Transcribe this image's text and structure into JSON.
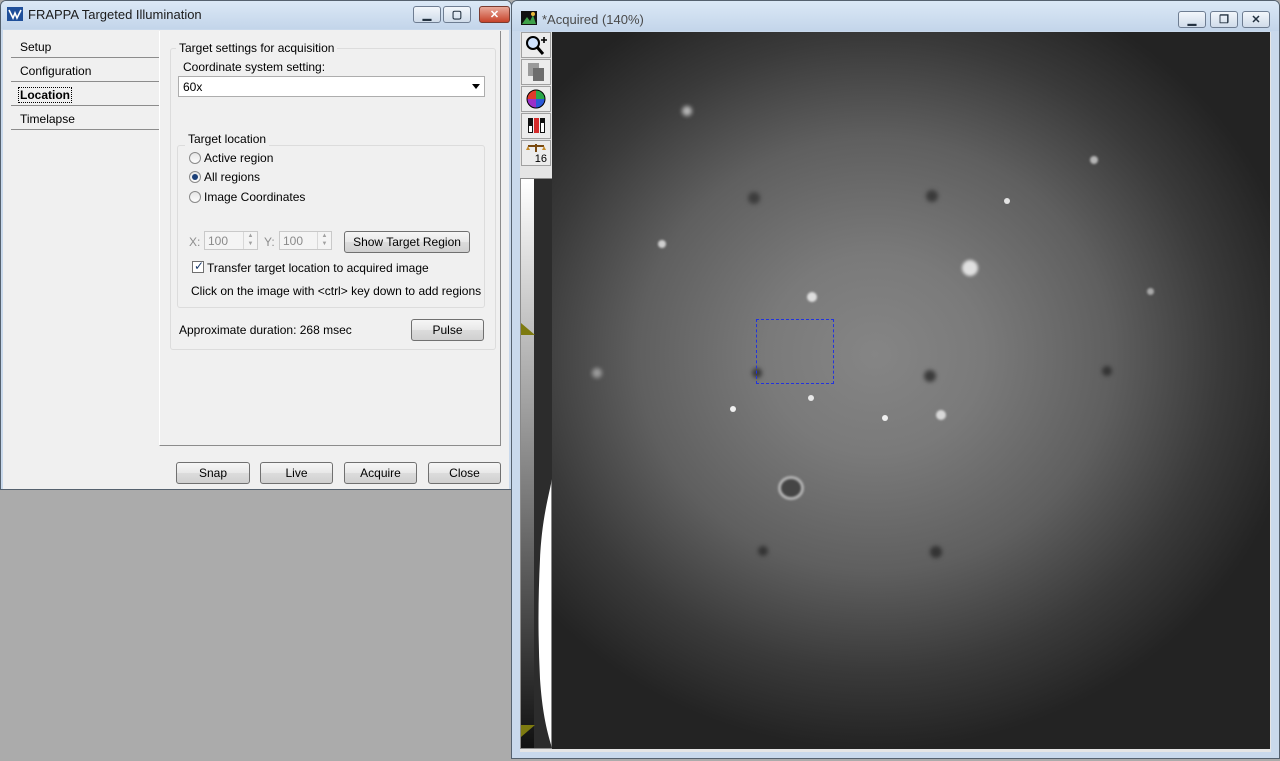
{
  "frappa": {
    "title": "FRAPPA Targeted Illumination",
    "tabs": [
      {
        "label": "Setup"
      },
      {
        "label": "Configuration"
      },
      {
        "label": "Location"
      },
      {
        "label": "Timelapse"
      }
    ],
    "active_tab": "Location",
    "target_settings": {
      "group_title": "Target settings for acquisition",
      "coord_label": "Coordinate system setting:",
      "coord_value": "60x"
    },
    "target_location": {
      "group_title": "Target location",
      "options": [
        {
          "label": "Active region",
          "selected": false
        },
        {
          "label": "All regions",
          "selected": true
        },
        {
          "label": "Image Coordinates",
          "selected": false
        }
      ],
      "x_label": "X:",
      "x_value": "100",
      "y_label": "Y:",
      "y_value": "100",
      "show_target_button": "Show Target Region",
      "transfer_checkbox_label": "Transfer target location to acquired image",
      "transfer_checked": true,
      "hint": "Click on the image with <ctrl> key down to add regions"
    },
    "duration_text": "Approximate duration: 268 msec",
    "pulse_button": "Pulse",
    "footer_buttons": {
      "snap": "Snap",
      "live": "Live",
      "acquire": "Acquire",
      "close": "Close"
    }
  },
  "image_window": {
    "title": "*Acquired (140%)",
    "tools": [
      "zoom-icon",
      "copy-icon",
      "color-wheel-icon",
      "channels-icon",
      "scale-icon"
    ],
    "bit_depth_label": "16"
  }
}
